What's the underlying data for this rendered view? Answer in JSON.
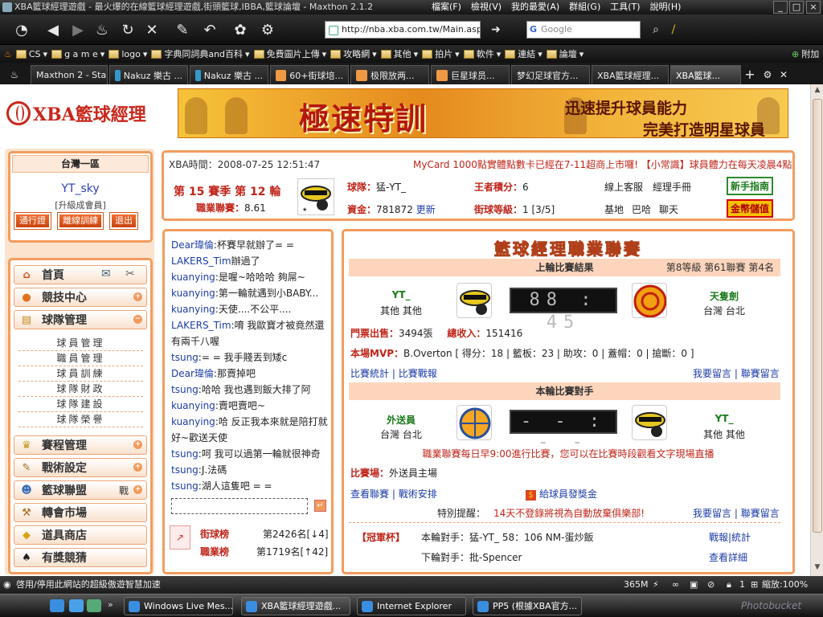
{
  "window": {
    "title": "XBA籃球經理遊戲 - 最火爆的在線籃球經理遊戲,街頭籃球,IBBA,籃球論壇 - Maxthon 2.1.2",
    "menu": [
      "檔案(F)",
      "檢視(V)",
      "我的最愛(A)",
      "群組(G)",
      "工具(T)",
      "說明(H)"
    ]
  },
  "toolbar": {
    "url": "http://nba.xba.com.tw/Main.asp",
    "search_placeholder": "Google",
    "search_logo": "G"
  },
  "favorites": {
    "items": [
      "CS",
      "g a m e",
      "logo",
      "字典同詞典and百科",
      "免費圖片上傳",
      "攻略網",
      "其他",
      "拍片",
      "軟件",
      "連結",
      "論壇"
    ],
    "add": "附加"
  },
  "tabs": [
    "Maxthon 2 - Start",
    "Nakuz 樂古 ...",
    "Nakuz 樂古 ...",
    "60+街球培...",
    "极限放两...",
    "巨星球员...",
    "梦幻足球官方...",
    "XBA籃球經理...",
    "XBA籃球..."
  ],
  "site": {
    "logo": "XBA籃球經理"
  },
  "banner": {
    "big": "極速特訓",
    "line1": "迅速提升球員能力",
    "line2": "完美打造明星球員"
  },
  "region": {
    "title": "台灣一區",
    "username": "YT_sky",
    "member": "[升級成會員]",
    "buttons": [
      "通行證",
      "離線訓練",
      "退出"
    ]
  },
  "nav": {
    "home": "首頁",
    "items": [
      {
        "label": "競技中心",
        "pm": "+"
      },
      {
        "label": "球隊管理",
        "pm": "−"
      }
    ],
    "sub": [
      "球員管理",
      "職員管理",
      "球員訓練",
      "球隊財政",
      "球隊建設",
      "球隊榮譽"
    ],
    "items2": [
      {
        "label": "賽程管理",
        "pm": "+"
      },
      {
        "label": "戰術設定",
        "pm": "+"
      },
      {
        "label": "籃球聯盟",
        "pm": "+",
        "extra": "戰"
      },
      {
        "label": "轉會市場",
        "pm": ""
      },
      {
        "label": "道具商店",
        "pm": ""
      },
      {
        "label": "有獎競猜",
        "pm": ""
      }
    ]
  },
  "info": {
    "time_label": "XBA時間：",
    "time": "2008-07-25 12:51:47",
    "marquee": "MyCard 1000點實體點數卡已經在7-11超商上市囉! 【小常識】球員體力在每天凌晨4點統",
    "season": "第 15 賽季 第 12 輪",
    "league_label": "職業聯賽：",
    "league_val": "8.61",
    "team_label": "球隊：",
    "team": "猛-YT_",
    "king_label": "王者積分：",
    "king": "6",
    "funds_label": "資金：",
    "funds": "781872",
    "update": "更新",
    "street_label": "街球等級：",
    "street": "1 [3/5]",
    "links1": [
      "線上客服",
      "經理手冊"
    ],
    "links2": [
      "基地",
      "巴哈",
      "聊天"
    ],
    "btn_guide": "新手指南",
    "btn_gold": "金幣儲值"
  },
  "chat": {
    "lines": [
      {
        "name": "Dear瑋倫",
        "text": ":杯賽早就辦了= ="
      },
      {
        "name": "LAKERS_Tim",
        "text": "辦過了"
      },
      {
        "name": "kuanying",
        "text": ":是喔~哈哈哈 夠屌~"
      },
      {
        "name": "kuanying",
        "text": ":第一輪就遇到小BABY..."
      },
      {
        "name": "kuanying",
        "text": ":天使....不公平...."
      },
      {
        "name": "LAKERS_Tim",
        "text": ":唷 我歐寶才被竟然還"
      },
      {
        "name": "",
        "text": "有兩千八喔"
      },
      {
        "name": "tsung",
        "text": ":= = 我手賤丟到矮c"
      },
      {
        "name": "Dear瑋倫",
        "text": ":那賣掉吧"
      },
      {
        "name": "tsung",
        "text": ":哈哈 我也遇到飯大排了阿"
      },
      {
        "name": "kuanying",
        "text": ":賣吧賣吧~"
      },
      {
        "name": "kuanying",
        "text": ":哈 反正我本來就是陪打就"
      },
      {
        "name": "",
        "text": "好~歡送天使"
      },
      {
        "name": "tsung",
        "text": ":呵 我可以過第一輪就很神奇"
      },
      {
        "name": "tsung",
        "text": ":J.法碼"
      },
      {
        "name": "tsung",
        "text": ":湖人這隻吧 = ="
      }
    ],
    "rank1_label": "街球榜",
    "rank1": "第2426名[↓4]",
    "rank2_label": "職業榜",
    "rank2": "第1719名[↑42]"
  },
  "league": {
    "title": "籃球經理職業聯賽",
    "last_header": "上輪比賽結果",
    "rank_info": "第8等級  第61聯賽  第4名",
    "home_name": "YT_",
    "home_loc": "其他 其他",
    "score": "88 : 45",
    "away_name": "天隻劍",
    "away_loc": "台灣 台北",
    "tickets_label": "門票出售：",
    "tickets": "3494張",
    "income_label": "總收入：",
    "income": "151416",
    "mvp_label": "本場MVP：",
    "mvp": "B.Overton [ 得分：18 | 籃板：23 | 助攻：0 | 蓋帽：0 | 搶斷：0 ]",
    "links_a": [
      "比賽統計",
      "比賽戰報"
    ],
    "links_b": [
      "我要留言",
      "聯賽留言"
    ],
    "next_header": "本輪比賽對手",
    "opp_name": "外送員",
    "opp_loc": "台灣 台北",
    "next_score": "- - : - -",
    "me_name": "YT_",
    "me_loc": "其他 其他",
    "notice": "職業聯賽每日早9:00進行比賽，您可以在比賽時段觀看文字現場直播",
    "venue_label": "比賽場：",
    "venue": "外送員主場",
    "links_c": [
      "查看聯賽",
      "戰術安排"
    ],
    "prize": "給球員發獎金",
    "special_label": "特別提醒：",
    "special": "14天不登錄將視為自動放棄俱樂部!",
    "cup_label": "【冠軍杯】",
    "cup_opp_label": "本輪對手：",
    "cup_opp": "猛-YT_ 58：106 NM-蛋炒飯",
    "cup_next_label": "下輪對手：",
    "cup_next": "批-Spencer",
    "cup_link1": "戰報|統計",
    "cup_link2": "查看詳細"
  },
  "statusbar": {
    "text": "啓用/停用此網站的超級傲遊智慧加速",
    "memory": "365M",
    "tabs": "1",
    "zoom": "縮放:100%"
  },
  "taskbar": {
    "items": [
      "Windows Live Mes...",
      "XBA籃球經理遊戲...",
      "Internet Explorer",
      "PP5 (根據XBA官方..."
    ],
    "watermark": "Photobucket"
  }
}
